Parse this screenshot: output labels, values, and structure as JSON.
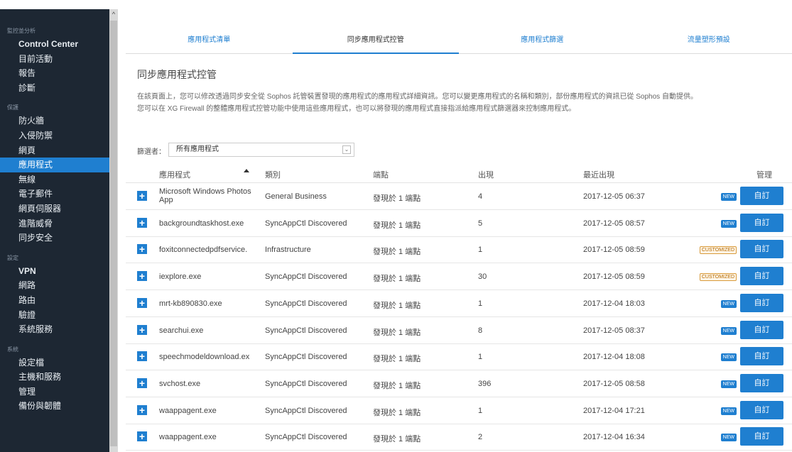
{
  "sidebar": {
    "sections": [
      {
        "title": "監控並分析",
        "items": [
          "Control Center",
          "目前活動",
          "報告",
          "診斷"
        ]
      },
      {
        "title": "保護",
        "items": [
          "防火牆",
          "入侵防禦",
          "網頁",
          "應用程式",
          "無線",
          "電子郵件",
          "網頁伺服器",
          "進階威脅",
          "同步安全"
        ]
      },
      {
        "title": "設定",
        "items": [
          "VPN",
          "網路",
          "路由",
          "驗證",
          "系統服務"
        ]
      },
      {
        "title": "系統",
        "items": [
          "設定檔",
          "主機和服務",
          "管理",
          "備份與韌體"
        ]
      }
    ],
    "active_item": "應用程式"
  },
  "tabs": [
    "應用程式清單",
    "同步應用程式控管",
    "應用程式篩選",
    "流量塑形預設"
  ],
  "active_tab": "同步應用程式控管",
  "page": {
    "title": "同步應用程式控管",
    "description_line1": "在該頁面上，您可以修改透過同步安全從 Sophos 託管裝置發現的應用程式的應用程式詳細資訊。您可以變更應用程式的名稱和類別，部份應用程式的資訊已從 Sophos 自動提供。",
    "description_line2": "您可以在 XG Firewall 的整體應用程式控管功能中使用這些應用程式，也可以將發現的應用程式直接指派給應用程式篩選器來控制應用程式。"
  },
  "filter": {
    "label": "篩選者：",
    "value": "所有應用程式"
  },
  "table": {
    "headers": {
      "app": "應用程式",
      "category": "類別",
      "endpoint": "端點",
      "occurrences": "出現",
      "last_seen": "最近出現",
      "manage": "管理"
    },
    "rows": [
      {
        "app": "Microsoft Windows Photos App",
        "category": "General Business",
        "endpoint": "發現於 1 端點",
        "occurrences": "4",
        "last_seen": "2017-12-05 06:37",
        "badge": "NEW",
        "button": "自訂"
      },
      {
        "app": "backgroundtaskhost.exe",
        "category": "SyncAppCtl Discovered",
        "endpoint": "發現於 1 端點",
        "occurrences": "5",
        "last_seen": "2017-12-05 08:57",
        "badge": "NEW",
        "button": "自訂"
      },
      {
        "app": "foxitconnectedpdfservice.",
        "category": "Infrastructure",
        "endpoint": "發現於 1 端點",
        "occurrences": "1",
        "last_seen": "2017-12-05 08:59",
        "badge": "CUSTOMIZED",
        "button": "自訂"
      },
      {
        "app": "iexplore.exe",
        "category": "SyncAppCtl Discovered",
        "endpoint": "發現於 1 端點",
        "occurrences": "30",
        "last_seen": "2017-12-05 08:59",
        "badge": "CUSTOMIZED",
        "button": "自訂"
      },
      {
        "app": "mrt-kb890830.exe",
        "category": "SyncAppCtl Discovered",
        "endpoint": "發現於 1 端點",
        "occurrences": "1",
        "last_seen": "2017-12-04 18:03",
        "badge": "NEW",
        "button": "自訂"
      },
      {
        "app": "searchui.exe",
        "category": "SyncAppCtl Discovered",
        "endpoint": "發現於 1 端點",
        "occurrences": "8",
        "last_seen": "2017-12-05 08:37",
        "badge": "NEW",
        "button": "自訂"
      },
      {
        "app": "speechmodeldownload.ex",
        "category": "SyncAppCtl Discovered",
        "endpoint": "發現於 1 端點",
        "occurrences": "1",
        "last_seen": "2017-12-04 18:08",
        "badge": "NEW",
        "button": "自訂"
      },
      {
        "app": "svchost.exe",
        "category": "SyncAppCtl Discovered",
        "endpoint": "發現於 1 端點",
        "occurrences": "396",
        "last_seen": "2017-12-05 08:58",
        "badge": "NEW",
        "button": "自訂"
      },
      {
        "app": "waappagent.exe",
        "category": "SyncAppCtl Discovered",
        "endpoint": "發現於 1 端點",
        "occurrences": "1",
        "last_seen": "2017-12-04 17:21",
        "badge": "NEW",
        "button": "自訂"
      },
      {
        "app": "waappagent.exe",
        "category": "SyncAppCtl Discovered",
        "endpoint": "發現於 1 端點",
        "occurrences": "2",
        "last_seen": "2017-12-04 16:34",
        "badge": "NEW",
        "button": "自訂"
      }
    ]
  }
}
